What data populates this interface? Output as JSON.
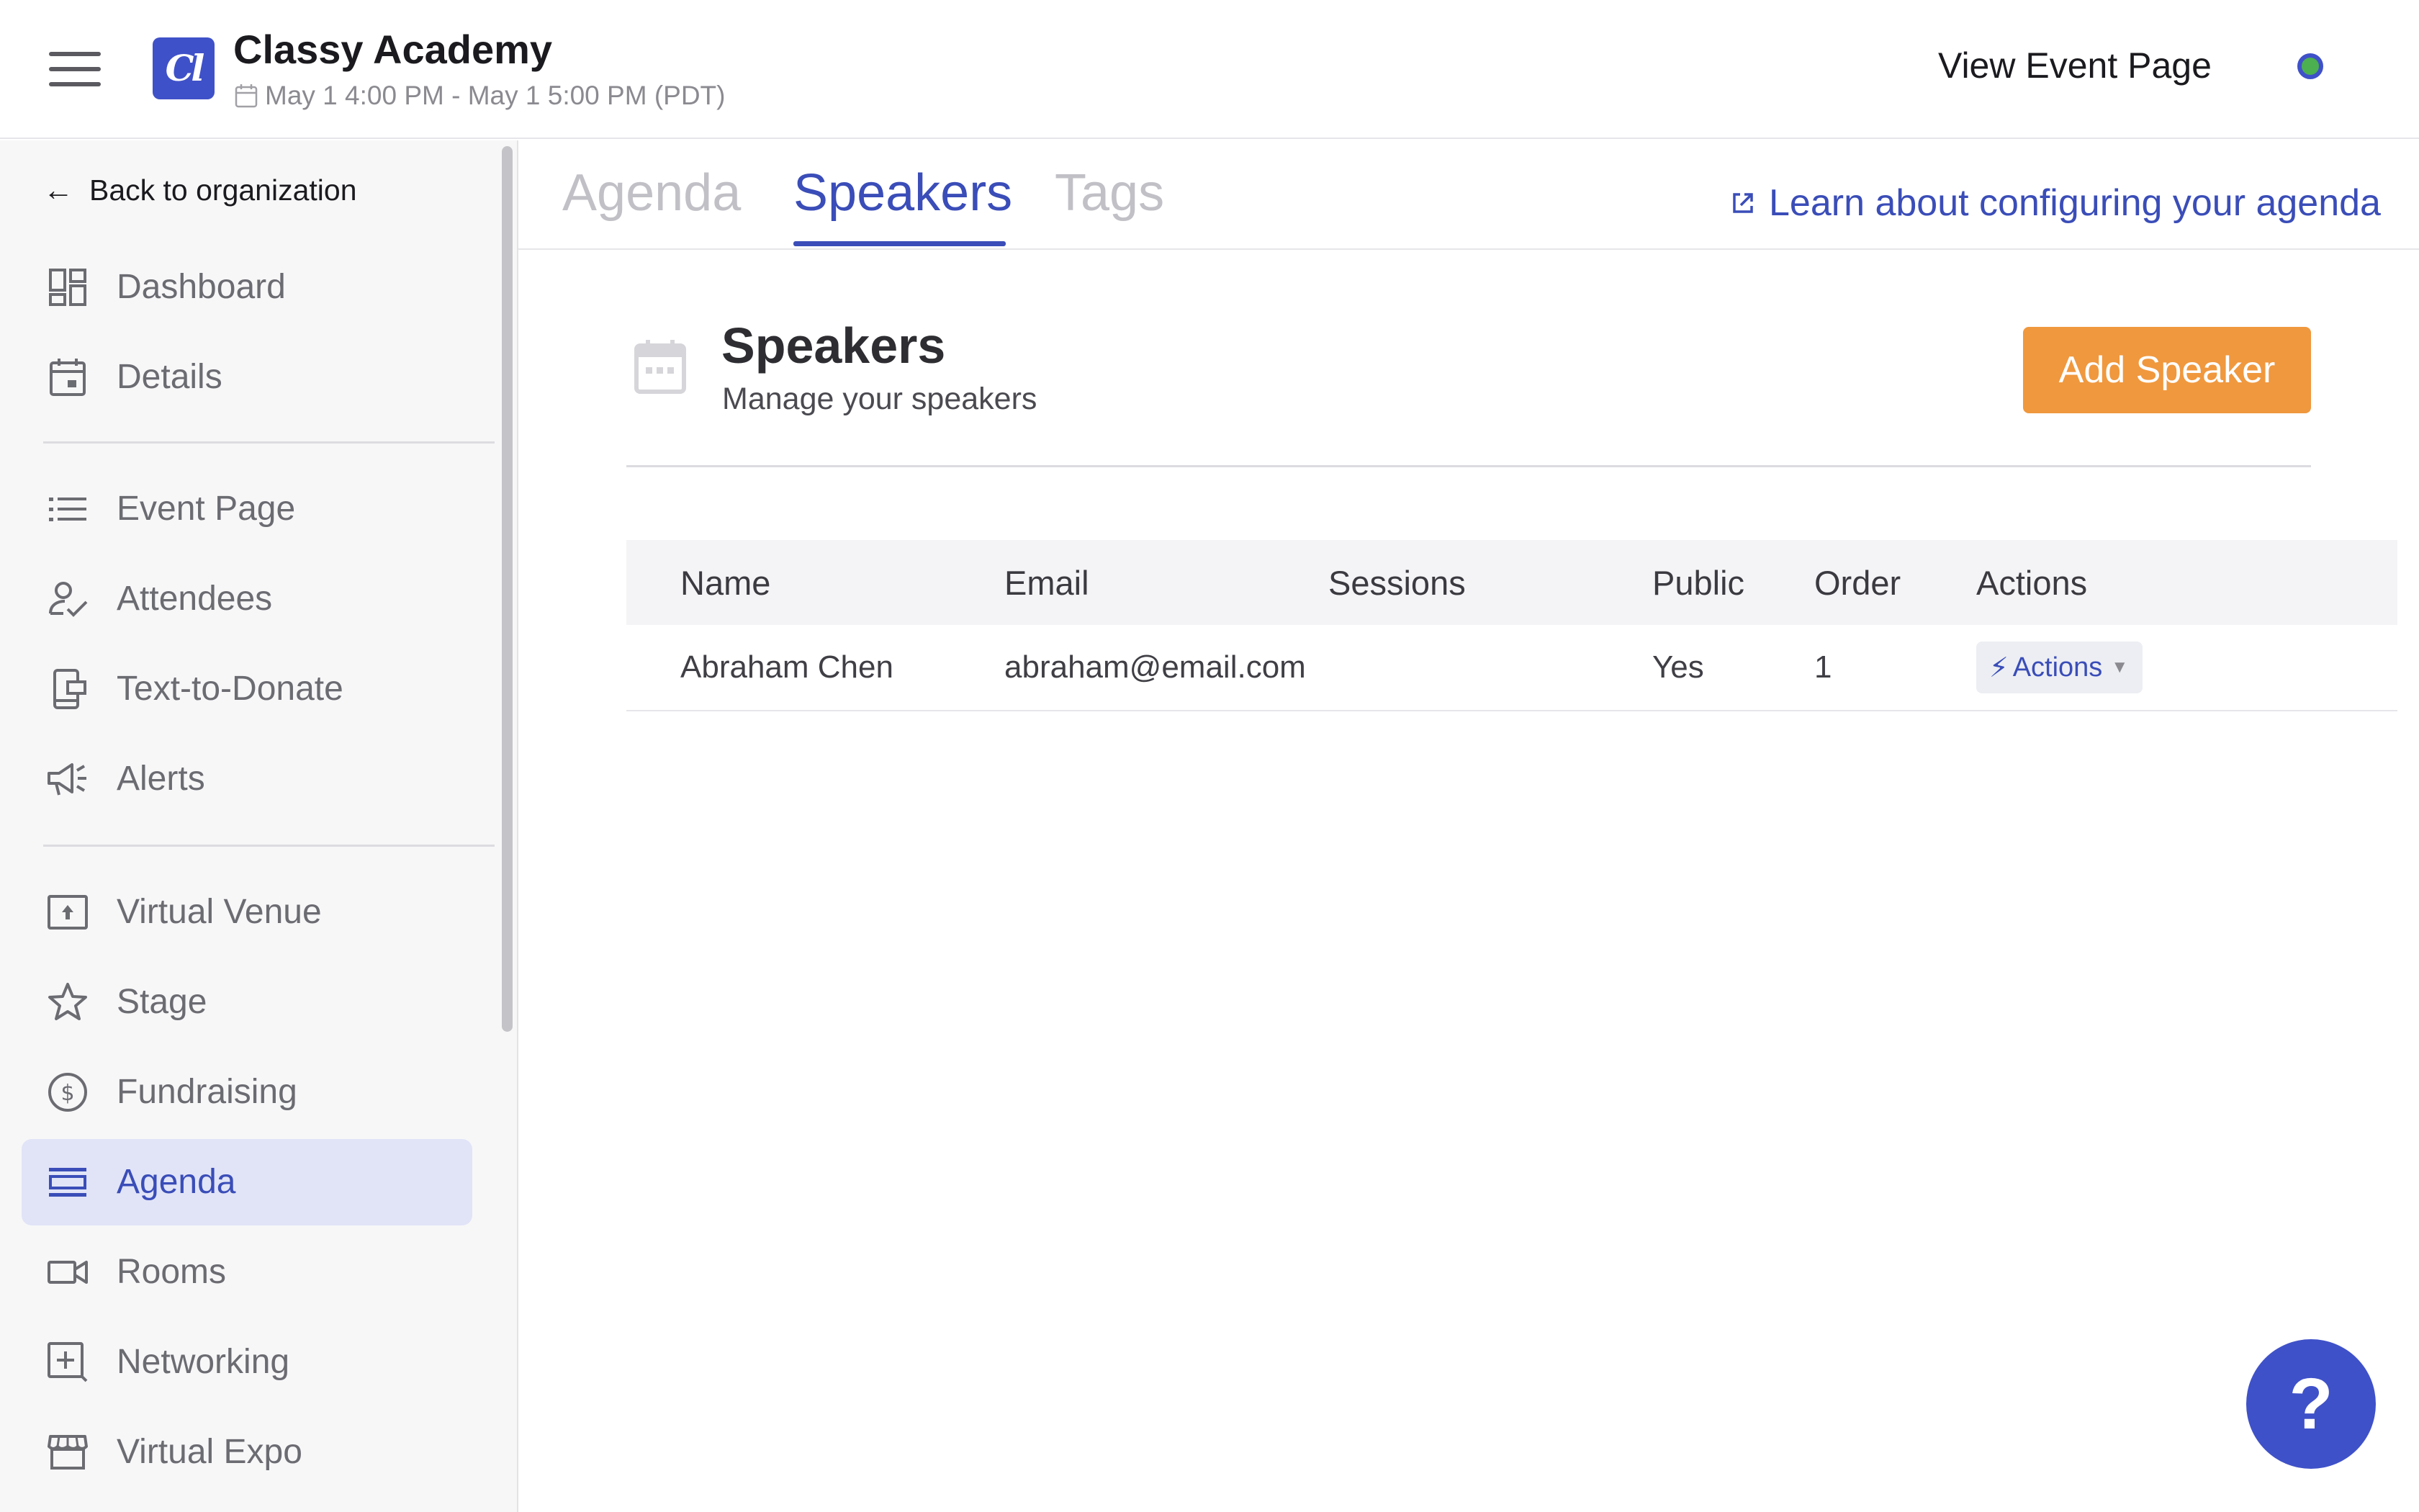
{
  "topbar": {
    "logo_text": "Cl",
    "org_title": "Classy Academy",
    "event_date": "May 1 4:00 PM - May 1 5:00 PM (PDT)",
    "view_event_label": "View Event Page",
    "status_color": "#4caf50"
  },
  "sidebar": {
    "back_label": "Back to organization",
    "groups": [
      [
        {
          "label": "Dashboard",
          "icon": "dashboard-icon"
        },
        {
          "label": "Details",
          "icon": "calendar-icon"
        }
      ],
      [
        {
          "label": "Event Page",
          "icon": "list-icon"
        },
        {
          "label": "Attendees",
          "icon": "person-check-icon"
        },
        {
          "label": "Text-to-Donate",
          "icon": "phone-icon"
        },
        {
          "label": "Alerts",
          "icon": "megaphone-icon"
        }
      ],
      [
        {
          "label": "Virtual Venue",
          "icon": "venue-icon"
        },
        {
          "label": "Stage",
          "icon": "star-icon"
        },
        {
          "label": "Fundraising",
          "icon": "dollar-icon"
        },
        {
          "label": "Agenda",
          "icon": "agenda-icon",
          "active": true
        },
        {
          "label": "Rooms",
          "icon": "video-icon"
        },
        {
          "label": "Networking",
          "icon": "add-box-icon"
        },
        {
          "label": "Virtual Expo",
          "icon": "store-icon"
        }
      ]
    ]
  },
  "tabs": [
    {
      "label": "Agenda",
      "active": false
    },
    {
      "label": "Speakers",
      "active": true
    },
    {
      "label": "Tags",
      "active": false
    }
  ],
  "learn_link": "Learn about configuring your agenda",
  "section": {
    "title": "Speakers",
    "subtitle": "Manage your speakers",
    "add_button": "Add Speaker"
  },
  "table": {
    "columns": [
      "Name",
      "Email",
      "Sessions",
      "Public",
      "Order",
      "Actions"
    ],
    "rows": [
      {
        "name": "Abraham Chen",
        "email": "abraham@email.com",
        "sessions": "",
        "public": "Yes",
        "order": "1",
        "actions_label": "Actions"
      }
    ]
  },
  "help_label": "?",
  "colors": {
    "brand": "#3f51c8",
    "accent_orange": "#f0983e",
    "active_nav_bg": "#e1e4f7"
  }
}
